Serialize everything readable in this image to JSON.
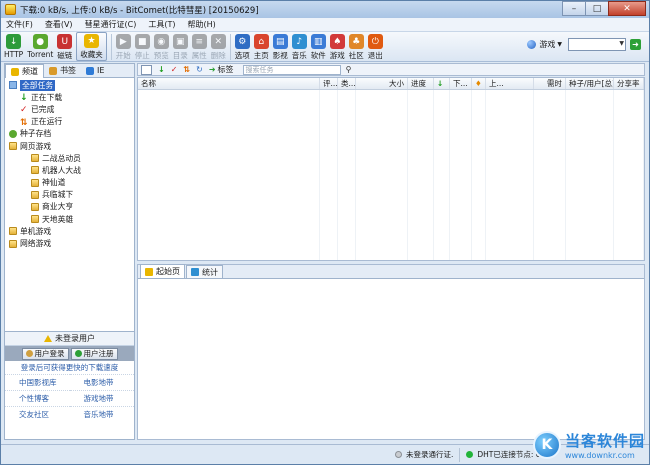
{
  "window": {
    "title": "下载:0 kB/s, 上传:0 kB/s - BitComet(比特彗星) [20150629]"
  },
  "menu": [
    "文件(F)",
    "查看(V)",
    "彗星通行证(C)",
    "工具(T)",
    "帮助(H)"
  ],
  "toolbar": {
    "buttons": [
      {
        "label": "HTTP",
        "icon": "http-download-icon",
        "color": "#2e9b3a",
        "disabled": false
      },
      {
        "label": "Torrent",
        "icon": "torrent-icon",
        "color": "#5aa82f",
        "disabled": false
      },
      {
        "label": "磁链",
        "icon": "magnet-icon",
        "color": "#c83232",
        "disabled": false
      },
      {
        "label": "收藏夹",
        "icon": "star-icon",
        "color": "#e9b600",
        "disabled": false,
        "active": true
      },
      {
        "label": "开始",
        "icon": "start-icon",
        "color": "#6a6a6a",
        "disabled": true
      },
      {
        "label": "停止",
        "icon": "stop-icon",
        "color": "#6a6a6a",
        "disabled": true
      },
      {
        "label": "预览",
        "icon": "preview-icon",
        "color": "#6a6a6a",
        "disabled": true
      },
      {
        "label": "目录",
        "icon": "folder-icon",
        "color": "#6a6a6a",
        "disabled": true
      },
      {
        "label": "属性",
        "icon": "properties-icon",
        "color": "#6a6a6a",
        "disabled": true
      },
      {
        "label": "删除",
        "icon": "delete-icon",
        "color": "#6a6a6a",
        "disabled": true
      },
      {
        "label": "选项",
        "icon": "options-icon",
        "color": "#2f6dc4",
        "disabled": false
      },
      {
        "label": "主页",
        "icon": "home-icon",
        "color": "#d9452e",
        "disabled": false
      },
      {
        "label": "影视",
        "icon": "video-icon",
        "color": "#3b7bd6",
        "disabled": false
      },
      {
        "label": "音乐",
        "icon": "music-icon",
        "color": "#2f8fd1",
        "disabled": false
      },
      {
        "label": "软件",
        "icon": "software-icon",
        "color": "#3b7bd6",
        "disabled": false
      },
      {
        "label": "游戏",
        "icon": "game-icon",
        "color": "#d23a3a",
        "disabled": false
      },
      {
        "label": "社区",
        "icon": "community-icon",
        "color": "#e0872a",
        "disabled": false
      },
      {
        "label": "退出",
        "icon": "power-icon",
        "color": "#e05a10",
        "disabled": false
      }
    ],
    "search_category": "游戏",
    "search_value": ""
  },
  "left": {
    "tabs": [
      "频道",
      "书签",
      "IE"
    ],
    "tree": [
      {
        "label": "全部任务",
        "icon": "all-tasks-icon",
        "indent": 0,
        "selected": true
      },
      {
        "label": "正在下载",
        "icon": "downloading-icon",
        "indent": 1
      },
      {
        "label": "已完成",
        "icon": "completed-icon",
        "indent": 1
      },
      {
        "label": "正在运行",
        "icon": "running-icon",
        "indent": 1
      },
      {
        "label": "种子存档",
        "icon": "torrent-archive-icon",
        "indent": 0
      },
      {
        "label": "网页游戏",
        "icon": "folder-icon",
        "indent": 0
      },
      {
        "label": "二战总动员",
        "icon": "folder-icon",
        "indent": 2
      },
      {
        "label": "机器人大战",
        "icon": "folder-icon",
        "indent": 2
      },
      {
        "label": "神仙道",
        "icon": "folder-icon",
        "indent": 2
      },
      {
        "label": "兵临城下",
        "icon": "folder-icon",
        "indent": 2
      },
      {
        "label": "商业大亨",
        "icon": "folder-icon",
        "indent": 2
      },
      {
        "label": "天地英雄",
        "icon": "folder-icon",
        "indent": 2
      },
      {
        "label": "单机游戏",
        "icon": "folder-icon",
        "indent": 0
      },
      {
        "label": "网络游戏",
        "icon": "folder-icon",
        "indent": 0
      }
    ],
    "user": {
      "status": "未登录用户",
      "login": "用户登录",
      "register": "用户注册",
      "promo": "登录后可获得更快的下载速度",
      "links": [
        "中国影视库",
        "电影地带",
        "个性博客",
        "游戏地带",
        "交友社区",
        "音乐地带"
      ]
    }
  },
  "task_toolbar": {
    "tag_label": "标签",
    "search_placeholder": "搜索任务"
  },
  "columns": [
    {
      "label": "名称",
      "w": 182,
      "align": "l"
    },
    {
      "label": "评...",
      "w": 18,
      "align": "l"
    },
    {
      "label": "类...",
      "w": 18,
      "align": "l"
    },
    {
      "label": "大小",
      "w": 52,
      "align": "r"
    },
    {
      "label": "进度",
      "w": 26,
      "align": "l"
    },
    {
      "label": "",
      "w": 16,
      "align": "l",
      "icon": "down"
    },
    {
      "label": "下...",
      "w": 22,
      "align": "l"
    },
    {
      "label": "",
      "w": 14,
      "align": "l",
      "icon": "up"
    },
    {
      "label": "上...",
      "w": 48,
      "align": "l"
    },
    {
      "label": "需时",
      "w": 32,
      "align": "r"
    },
    {
      "label": "种子/用户[总]",
      "w": 48,
      "align": "l"
    },
    {
      "label": "分享率",
      "w": 30,
      "align": "l"
    }
  ],
  "bottom_tabs": [
    "起始页",
    "统计"
  ],
  "status": {
    "unlogged": "未登录通行证.",
    "dht": "DHT已连接节点: 0"
  },
  "watermark": {
    "title": "当客软件园",
    "sub": "www.downkr.com"
  }
}
